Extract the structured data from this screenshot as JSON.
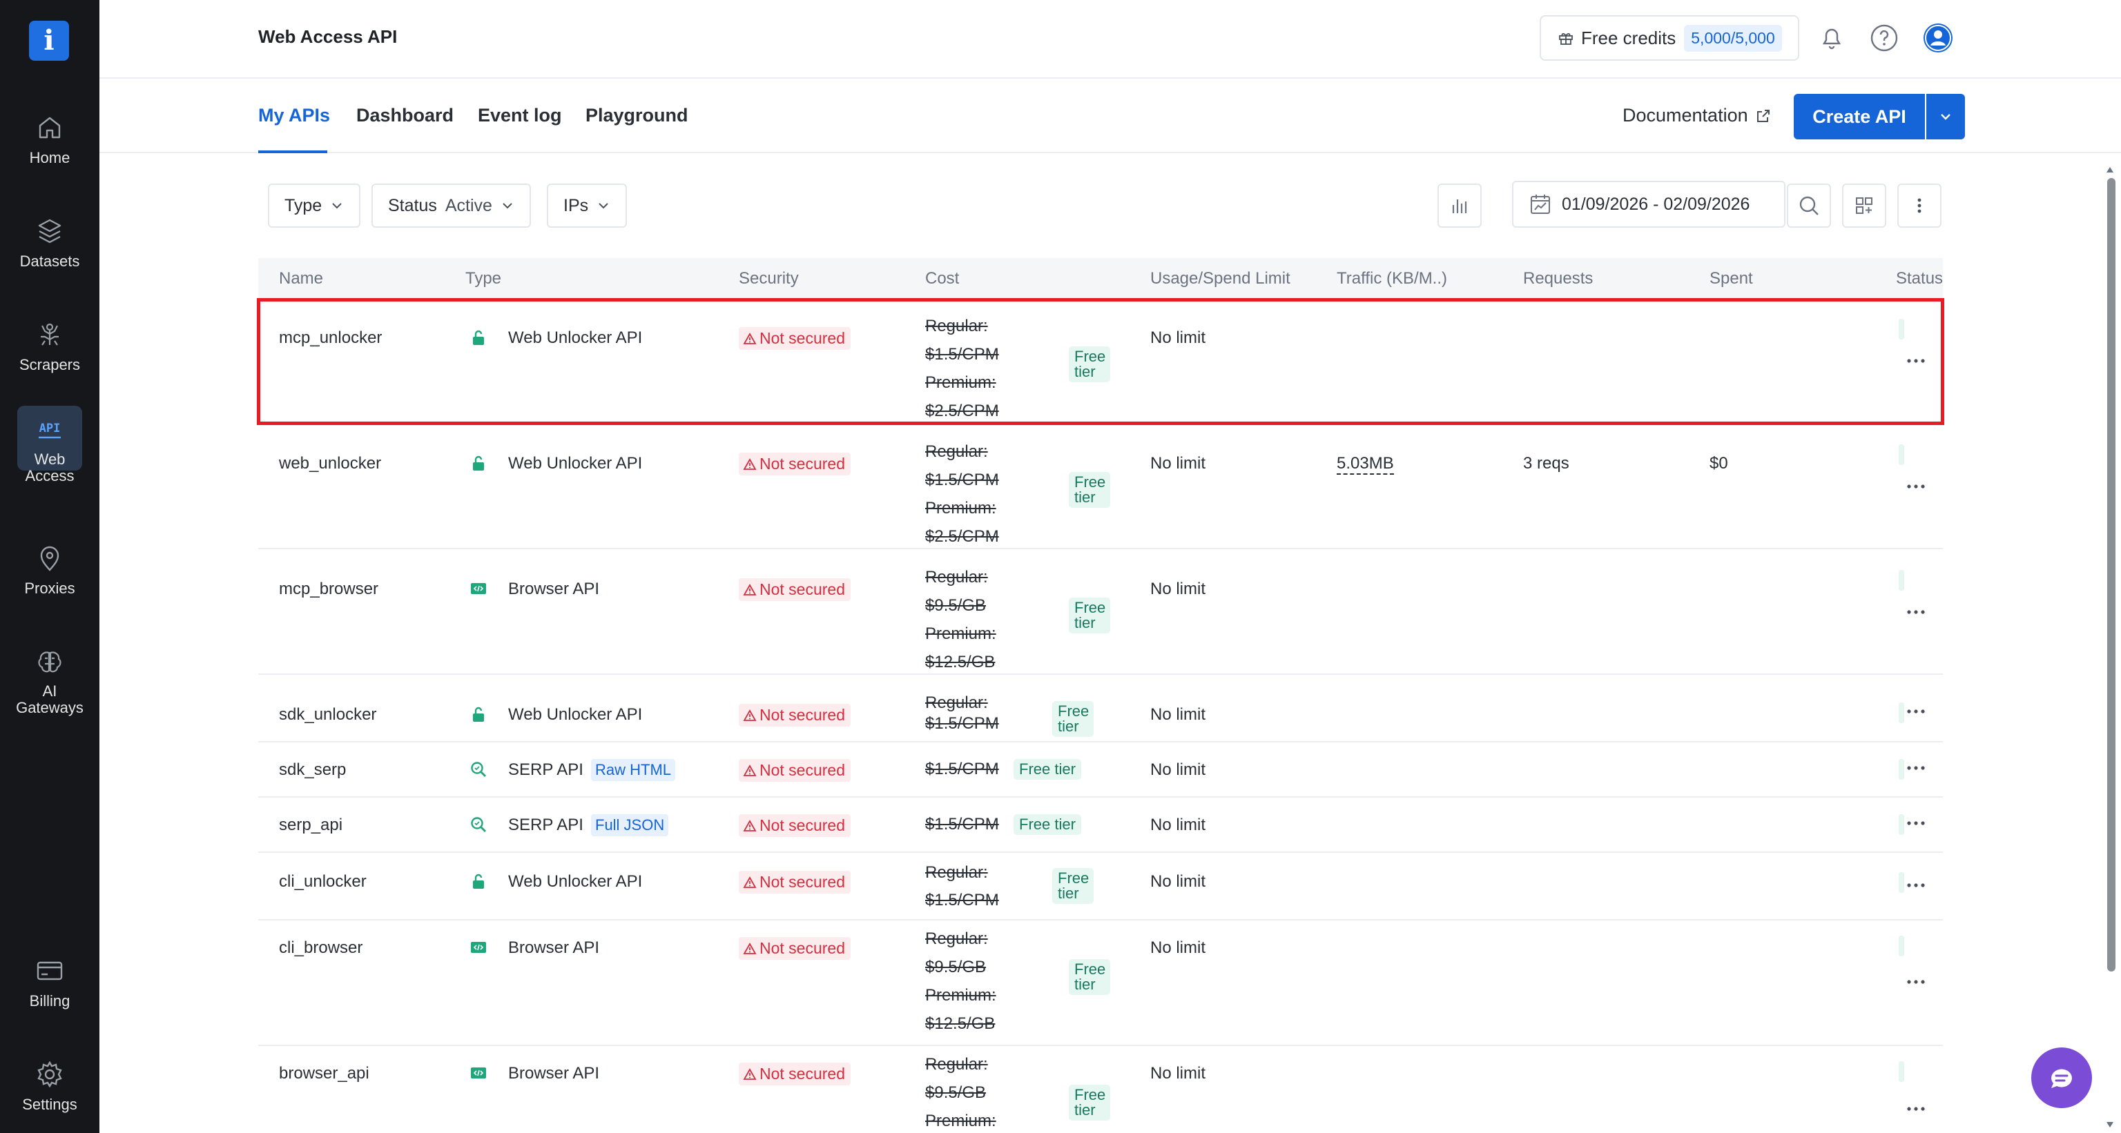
{
  "sidebar": {
    "items": [
      {
        "label": "Home",
        "icon": "home-icon"
      },
      {
        "label": "Datasets",
        "icon": "datasets-icon"
      },
      {
        "label": "Scrapers",
        "icon": "scrapers-icon"
      },
      {
        "label_line1": "Web",
        "label_line2": "Access",
        "icon": "api-icon",
        "active": true
      },
      {
        "label": "Proxies",
        "icon": "proxies-icon"
      },
      {
        "label_line1": "AI",
        "label_line2": "Gateways",
        "icon": "ai-gateways-icon"
      },
      {
        "label": "Billing",
        "icon": "billing-icon"
      },
      {
        "label": "Settings",
        "icon": "settings-icon"
      }
    ]
  },
  "header": {
    "title": "Web Access API",
    "credits_label": "Free credits",
    "credits_value": "5,000/5,000"
  },
  "tabs": [
    {
      "label": "My APIs",
      "active": true
    },
    {
      "label": "Dashboard"
    },
    {
      "label": "Event log"
    },
    {
      "label": "Playground"
    }
  ],
  "actions": {
    "documentation": "Documentation",
    "create_api": "Create API"
  },
  "filters": {
    "type_label": "Type",
    "status_label": "Status",
    "status_value": "Active",
    "ips_label": "IPs",
    "date_range": "01/09/2026 - 02/09/2026"
  },
  "table": {
    "columns": [
      "Name",
      "Type",
      "Security",
      "Cost",
      "Usage/Spend Limit",
      "Traffic (KB/M..)",
      "Requests",
      "Spent",
      "Status"
    ],
    "rows": [
      {
        "name": "mcp_unlocker",
        "type": "Web Unlocker API",
        "security": "Not secured",
        "cost_lines": [
          "Regular:",
          "$1.5/CPM",
          "Premium:",
          "$2.5/CPM"
        ],
        "free_tier": "Free tier",
        "limit": "No limit",
        "traffic": "",
        "requests": "",
        "spent": ""
      },
      {
        "name": "web_unlocker",
        "type": "Web Unlocker API",
        "security": "Not secured",
        "cost_lines": [
          "Regular:",
          "$1.5/CPM",
          "Premium:",
          "$2.5/CPM"
        ],
        "free_tier": "Free tier",
        "limit": "No limit",
        "traffic": "5.03MB",
        "requests": "3 reqs",
        "spent": "$0"
      },
      {
        "name": "mcp_browser",
        "type": "Browser API",
        "security": "Not secured",
        "cost_lines": [
          "Regular:",
          "$9.5/GB",
          "Premium:",
          "$12.5/GB"
        ],
        "free_tier": "Free tier",
        "limit": "No limit"
      },
      {
        "name": "sdk_unlocker",
        "type": "Web Unlocker API",
        "security": "Not secured",
        "cost_lines": [
          "Regular:",
          "$1.5/CPM"
        ],
        "free_tier": "Free tier",
        "limit": "No limit"
      },
      {
        "name": "sdk_serp",
        "type": "SERP API",
        "tag": "Raw HTML",
        "security": "Not secured",
        "cost_lines": [
          "$1.5/CPM"
        ],
        "free_tier": "Free tier",
        "limit": "No limit"
      },
      {
        "name": "serp_api",
        "type": "SERP API",
        "tag": "Full JSON",
        "security": "Not secured",
        "cost_lines": [
          "$1.5/CPM"
        ],
        "free_tier": "Free tier",
        "limit": "No limit"
      },
      {
        "name": "cli_unlocker",
        "type": "Web Unlocker API",
        "security": "Not secured",
        "cost_lines": [
          "Regular:",
          "$1.5/CPM"
        ],
        "free_tier": "Free tier",
        "limit": "No limit"
      },
      {
        "name": "cli_browser",
        "type": "Browser API",
        "security": "Not secured",
        "cost_lines": [
          "Regular:",
          "$9.5/GB",
          "Premium:",
          "$12.5/GB"
        ],
        "free_tier": "Free tier",
        "limit": "No limit"
      },
      {
        "name": "browser_api",
        "type": "Browser API",
        "security": "Not secured",
        "cost_lines": [
          "Regular:",
          "$9.5/GB",
          "Premium:"
        ],
        "free_tier": "Free tier",
        "limit": "No limit"
      }
    ]
  },
  "colors": {
    "accent": "#1565d8",
    "sidebar_bg": "#15171a",
    "danger": "#d32f3f",
    "success": "#177a5c",
    "highlight": "#e81c24"
  }
}
